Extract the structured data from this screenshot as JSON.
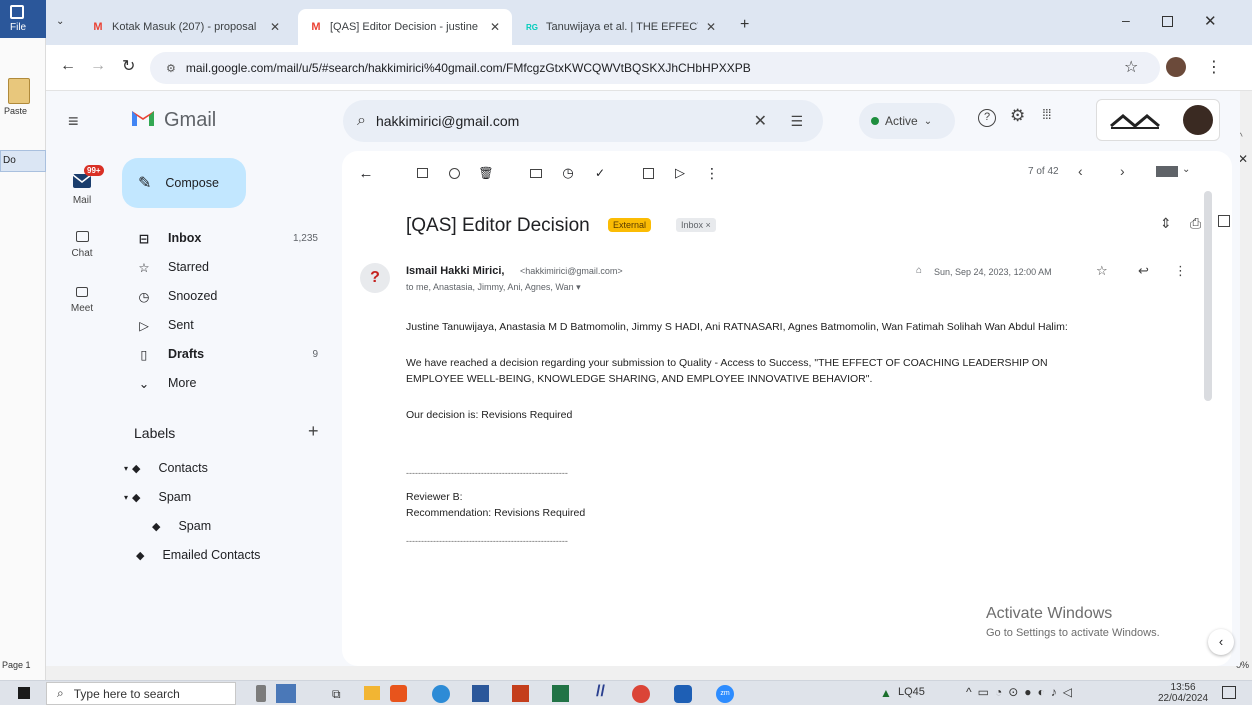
{
  "word": {
    "file_label": "File",
    "paste_label": "Paste",
    "doc_tab": "Do",
    "page_label": "Page 1",
    "zoom": "0%"
  },
  "browser": {
    "tabs": [
      {
        "favicon": "M",
        "title": "Kotak Masuk (207) - proposal"
      },
      {
        "favicon": "M",
        "title": "[QAS] Editor Decision - justine"
      },
      {
        "favicon": "RG",
        "title": "Tanuwijaya et al. | THE EFFECT"
      }
    ],
    "url": "mail.google.com/mail/u/5/#search/hakkimirici%40gmail.com/FMfcgzGtxKWCQWVtBQSKXJhCHbHPXXPB"
  },
  "gmail": {
    "logo_text": "Gmail",
    "rail": [
      {
        "label": "Mail",
        "badge": "99+"
      },
      {
        "label": "Chat"
      },
      {
        "label": "Meet"
      }
    ],
    "compose_label": "Compose",
    "nav": [
      {
        "label": "Inbox",
        "count": "1,235",
        "bold": true
      },
      {
        "label": "Starred",
        "count": ""
      },
      {
        "label": "Snoozed",
        "count": ""
      },
      {
        "label": "Sent",
        "count": ""
      },
      {
        "label": "Drafts",
        "count": "9",
        "bold": true
      },
      {
        "label": "More",
        "count": ""
      }
    ],
    "labels_title": "Labels",
    "labels": [
      "Contacts",
      "Spam",
      "Spam",
      "Emailed Contacts"
    ],
    "search_value": "hakkimirici@gmail.com",
    "status": "Active",
    "pagination": "7 of 42",
    "email": {
      "subject": "[QAS] Editor Decision",
      "tag_external": "External",
      "tag_inbox": "Inbox",
      "sender_name": "Ismail Hakki Mirici,",
      "sender_email": "<hakkimirici@gmail.com>",
      "recipients": "to me, Anastasia, Jimmy, Ani, Agnes, Wan",
      "date": "Sun, Sep 24, 2023, 12:00 AM",
      "avatar_char": "?",
      "line1": "Justine Tanuwijaya, Anastasia M D Batmomolin, Jimmy S HADI, Ani RATNASARI, Agnes Batmomolin, Wan Fatimah Solihah Wan Abdul Halim:",
      "line2a": "We have reached a decision regarding your submission to Quality - Access to Success, \"THE EFFECT OF COACHING LEADERSHIP ON",
      "line2b": "EMPLOYEE WELL-BEING, KNOWLEDGE SHARING, AND EMPLOYEE INNOVATIVE BEHAVIOR\".",
      "line3": "Our decision is: Revisions Required",
      "divider1": "------------------------------------------------------",
      "reviewer": "Reviewer B:",
      "recommendation": "Recommendation: Revisions Required",
      "divider2": "------------------------------------------------------"
    },
    "activate_title": "Activate Windows",
    "activate_sub": "Go to Settings to activate Windows."
  },
  "taskbar": {
    "search_placeholder": "Type here to search",
    "tray_label": "LQ45",
    "time": "13:56",
    "date": "22/04/2024"
  },
  "colors": {
    "gmail_red": "#ea4335",
    "compose_bg": "#c2e7ff",
    "external_tag": "#fbbc04",
    "active_green": "#1e8e3e",
    "word_blue": "#2b579a"
  }
}
